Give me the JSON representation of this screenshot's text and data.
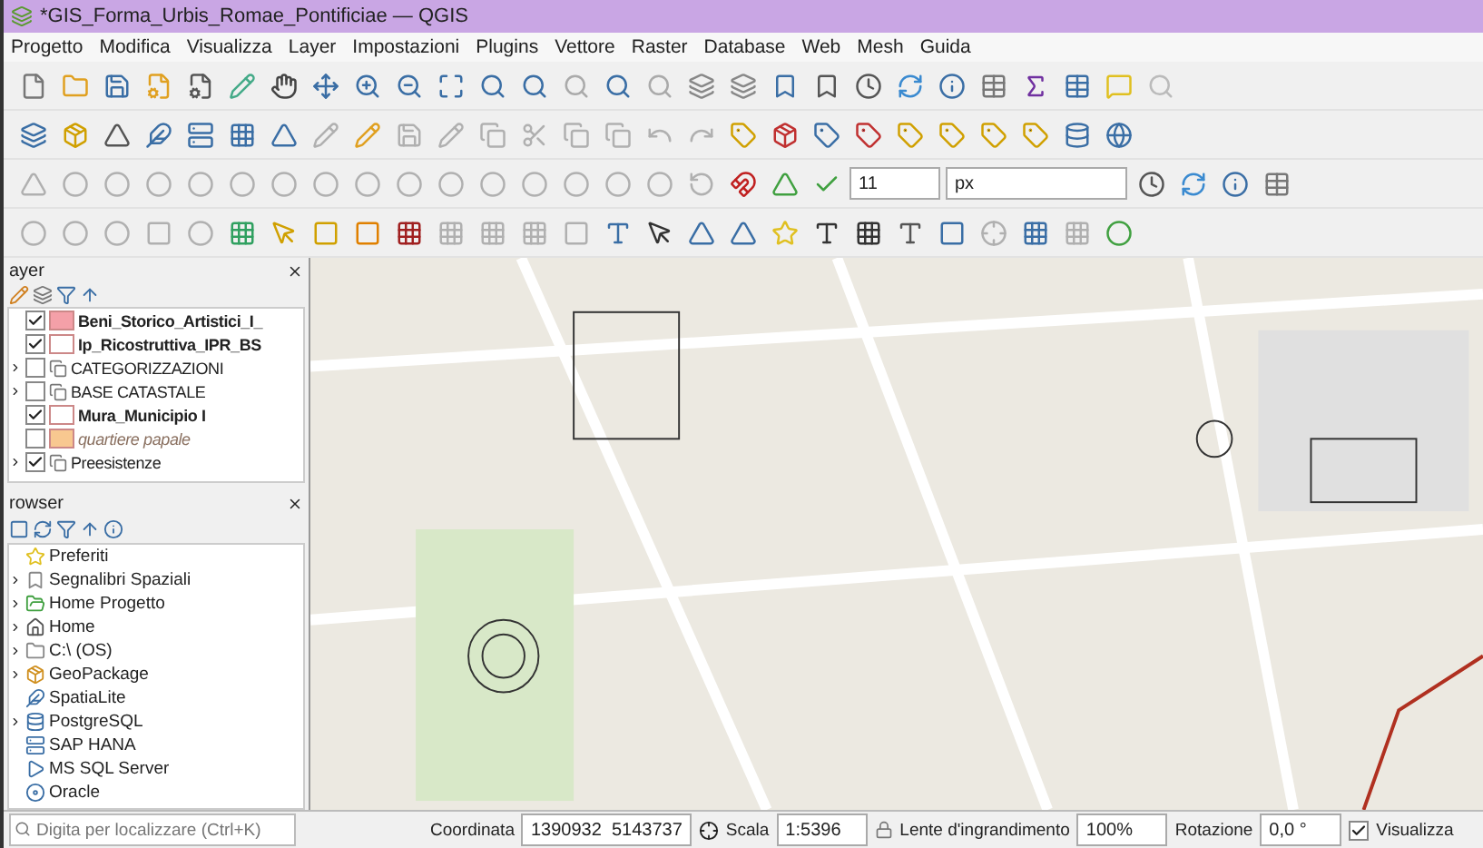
{
  "window": {
    "title": "*GIS_Forma_Urbis_Romae_Pontificiae — QGIS"
  },
  "menu": [
    "Progetto",
    "Modifica",
    "Visualizza",
    "Layer",
    "Impostazioni",
    "Plugins",
    "Vettore",
    "Raster",
    "Database",
    "Web",
    "Mesh",
    "Guida"
  ],
  "snapping": {
    "tolerance": "11",
    "unit": "px"
  },
  "layers_panel": {
    "title": "ayer",
    "items": [
      {
        "name": "Beni_Storico_Artistici_I_",
        "kind": "layer",
        "checked": true,
        "color": "#f4a0a8"
      },
      {
        "name": "Ip_Ricostruttiva_IPR_BS",
        "kind": "layer",
        "checked": true,
        "color": "#ffffff"
      },
      {
        "name": "CATEGORIZZAZIONI",
        "kind": "group",
        "checked": false
      },
      {
        "name": "BASE CATASTALE",
        "kind": "group",
        "checked": false
      },
      {
        "name": "Mura_Municipio I",
        "kind": "layer",
        "checked": true,
        "color": "#ffffff"
      },
      {
        "name": "quartiere papale",
        "kind": "category",
        "checked": false,
        "color": "#f8c890"
      },
      {
        "name": "Preesistenze",
        "kind": "group",
        "checked": true
      }
    ]
  },
  "browser_panel": {
    "title": "rowser",
    "items": [
      {
        "name": "Preferiti",
        "expandable": false
      },
      {
        "name": "Segnalibri Spaziali",
        "expandable": true
      },
      {
        "name": "Home Progetto",
        "expandable": true
      },
      {
        "name": "Home",
        "expandable": true
      },
      {
        "name": "C:\\ (OS)",
        "expandable": true
      },
      {
        "name": "GeoPackage",
        "expandable": true
      },
      {
        "name": "SpatiaLite",
        "expandable": false
      },
      {
        "name": "PostgreSQL",
        "expandable": true
      },
      {
        "name": "SAP HANA",
        "expandable": false
      },
      {
        "name": "MS SQL Server",
        "expandable": false
      },
      {
        "name": "Oracle",
        "expandable": false
      }
    ]
  },
  "locator": {
    "placeholder": "Digita per localizzare (Ctrl+K)"
  },
  "status_bar": {
    "coordinate_label": "Coordinata",
    "coordinate": "1390932  5143737",
    "scale_label": "Scala",
    "scale": "1:5396",
    "magnifier_label": "Lente d'ingrandimento",
    "magnifier": "100%",
    "rotation_label": "Rotazione",
    "rotation": "0,0 °",
    "render_label": "Visualizza",
    "render_checked": true
  }
}
